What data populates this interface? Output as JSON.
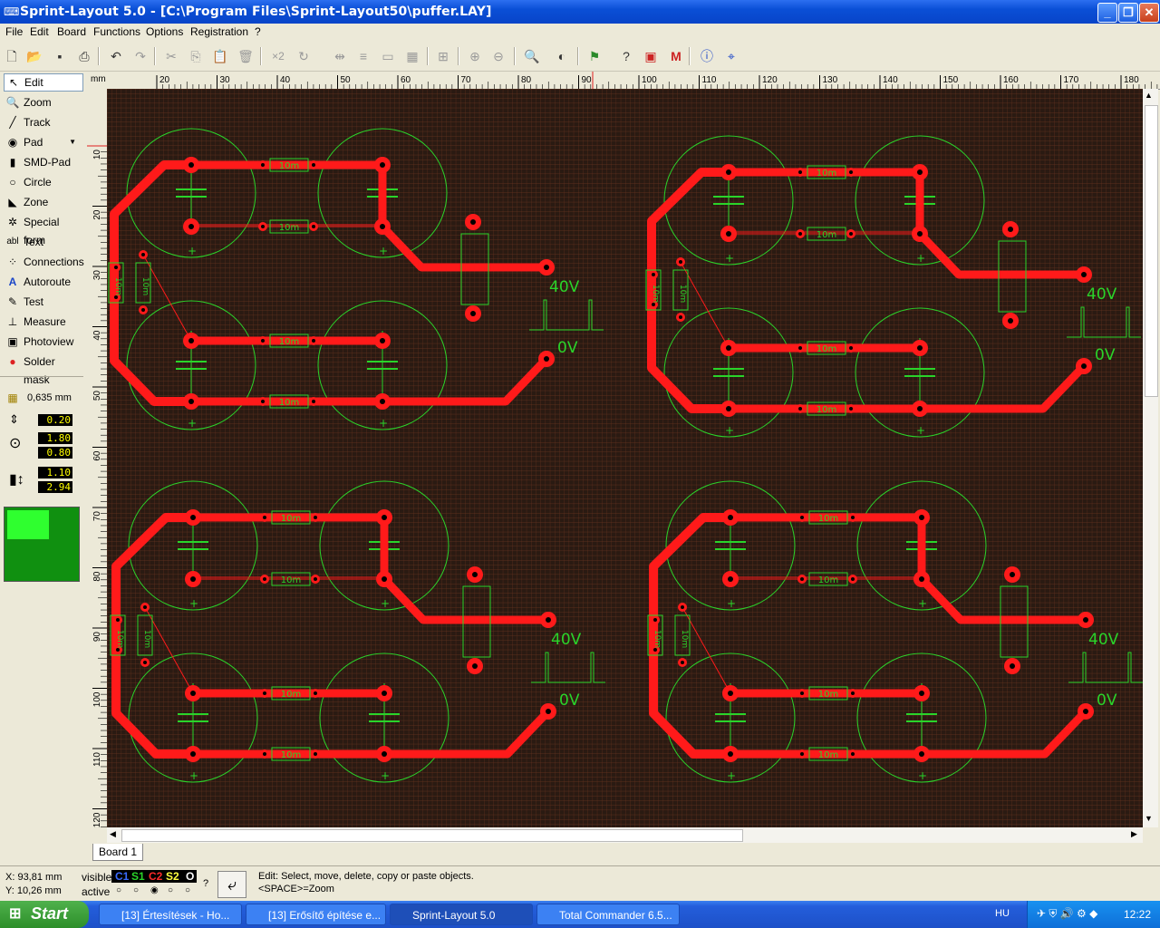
{
  "window": {
    "title": "Sprint-Layout 5.0 - [C:\\Program Files\\Sprint-Layout50\\puffer.LAY]",
    "buttons": [
      "_",
      "❐",
      "✕"
    ]
  },
  "menu": [
    "File",
    "Edit",
    "Board",
    "Functions",
    "Options",
    "Registration",
    "?"
  ],
  "tools": [
    {
      "label": "Edit",
      "icon": "arrow-icon"
    },
    {
      "label": "Zoom",
      "icon": "magnifier-icon"
    },
    {
      "label": "Track",
      "icon": "track-icon"
    },
    {
      "label": "Pad",
      "icon": "pad-icon"
    },
    {
      "label": "SMD-Pad",
      "icon": "smd-pad-icon"
    },
    {
      "label": "Circle",
      "icon": "circle-icon"
    },
    {
      "label": "Zone",
      "icon": "zone-icon"
    },
    {
      "label": "Special form",
      "icon": "special-form-icon"
    },
    {
      "label": "Text",
      "icon": "text-icon"
    },
    {
      "label": "Connections",
      "icon": "connections-icon"
    },
    {
      "label": "Autoroute",
      "icon": "autoroute-icon"
    },
    {
      "label": "Test",
      "icon": "test-icon"
    },
    {
      "label": "Measure",
      "icon": "measure-icon"
    },
    {
      "label": "Photoview",
      "icon": "photoview-icon"
    },
    {
      "label": "Solder mask",
      "icon": "solder-mask-icon"
    }
  ],
  "grid": {
    "value": "0,635 mm"
  },
  "params": {
    "track_width": "0.20",
    "pad_outer": "1.80",
    "pad_inner": "0.80",
    "smd_w": "1.10",
    "smd_h": "2.94"
  },
  "ruler": {
    "unit": "mm",
    "h_ticks": [
      "20",
      "30",
      "40",
      "50",
      "60",
      "70",
      "80",
      "90",
      "100",
      "110",
      "120",
      "130",
      "140",
      "150",
      "160",
      "170",
      "180"
    ],
    "v_ticks": [
      "10",
      "20",
      "30",
      "40",
      "50",
      "60",
      "70",
      "80",
      "90",
      "100",
      "110",
      "120"
    ]
  },
  "board_tab": "Board 1",
  "status": {
    "x": "X:  93,81 mm",
    "y": "Y:  10,26 mm",
    "visible_label": "visible",
    "active_label": "active",
    "layers": [
      "C1",
      "S1",
      "C2",
      "S2",
      "O"
    ],
    "question": "?",
    "hint_line1": "Edit: Select, move, delete, copy or paste objects.",
    "hint_line2": "<SPACE>=Zoom"
  },
  "pcb": {
    "resistor_label": "10m",
    "voltage_high": "40V",
    "voltage_low": "0V"
  },
  "taskbar": {
    "start": "Start",
    "tasks": [
      "[13] Értesítések - Ho...",
      "[13] Erősítő építése e...",
      "Sprint-Layout 5.0",
      "Total Commander 6.5..."
    ],
    "lang": "HU",
    "clock": "12:22"
  },
  "colors": {
    "copper": "#ff1a1a",
    "silk": "#2ad42a",
    "board": "#2a1a12",
    "grid": "#5a2818"
  }
}
